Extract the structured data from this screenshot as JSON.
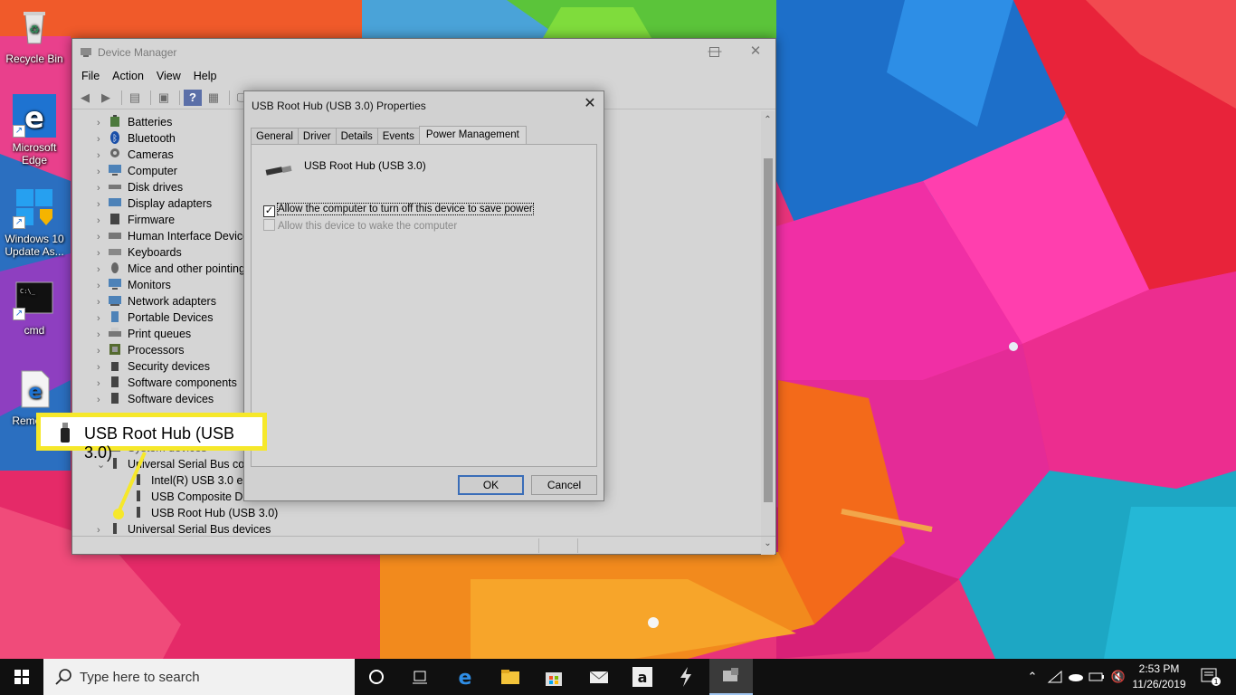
{
  "desktop": {
    "icons": [
      {
        "label": "Recycle Bin"
      },
      {
        "label": "Microsoft Edge"
      },
      {
        "label": "Windows 10 Update As..."
      },
      {
        "label": "cmd"
      },
      {
        "label": "Remo Ap"
      }
    ]
  },
  "device_manager": {
    "title": "Device Manager",
    "menu": [
      "File",
      "Action",
      "View",
      "Help"
    ],
    "tree": [
      {
        "label": "Batteries",
        "icon": "battery-icon"
      },
      {
        "label": "Bluetooth",
        "icon": "bluetooth-icon"
      },
      {
        "label": "Cameras",
        "icon": "camera-icon"
      },
      {
        "label": "Computer",
        "icon": "computer-icon"
      },
      {
        "label": "Disk drives",
        "icon": "disk-drive-icon"
      },
      {
        "label": "Display adapters",
        "icon": "display-adapter-icon"
      },
      {
        "label": "Firmware",
        "icon": "firmware-icon"
      },
      {
        "label": "Human Interface Device",
        "icon": "hid-icon"
      },
      {
        "label": "Keyboards",
        "icon": "keyboard-icon"
      },
      {
        "label": "Mice and other pointing",
        "icon": "mouse-icon"
      },
      {
        "label": "Monitors",
        "icon": "monitor-icon"
      },
      {
        "label": "Network adapters",
        "icon": "network-adapter-icon"
      },
      {
        "label": "Portable Devices",
        "icon": "portable-device-icon"
      },
      {
        "label": "Print queues",
        "icon": "printer-icon"
      },
      {
        "label": "Processors",
        "icon": "processor-icon"
      },
      {
        "label": "Security devices",
        "icon": "security-device-icon"
      },
      {
        "label": "Software components",
        "icon": "software-component-icon"
      },
      {
        "label": "Software devices",
        "icon": "software-device-icon"
      },
      {
        "label": "System devices",
        "icon": "system-device-icon"
      },
      {
        "label": "Universal Serial Bus cont",
        "icon": "usb-icon"
      },
      {
        "label": "Intel(R) USB 3.0 eXte",
        "icon": "usb-icon"
      },
      {
        "label": "USB Composite Devi",
        "icon": "usb-icon"
      },
      {
        "label": "USB Root Hub (USB 3.0)",
        "icon": "usb-icon"
      },
      {
        "label": "Universal Serial Bus devices",
        "icon": "usb-icon"
      }
    ]
  },
  "properties_dialog": {
    "title": "USB Root Hub (USB 3.0) Properties",
    "tabs": [
      "General",
      "Driver",
      "Details",
      "Events",
      "Power Management"
    ],
    "active_tab": "Power Management",
    "device_name": "USB Root Hub (USB 3.0)",
    "option_turn_off": "Allow the computer to turn off this device to save power",
    "option_turn_off_checked": true,
    "option_wake": "Allow this device to wake the computer",
    "option_wake_enabled": false,
    "ok_label": "OK",
    "cancel_label": "Cancel"
  },
  "callout": {
    "label": "USB Root Hub (USB 3.0)",
    "color": "#f6e82a"
  },
  "taskbar": {
    "search_placeholder": "Type here to search",
    "time": "2:53 PM",
    "date": "11/26/2019",
    "notification_count": "1"
  }
}
